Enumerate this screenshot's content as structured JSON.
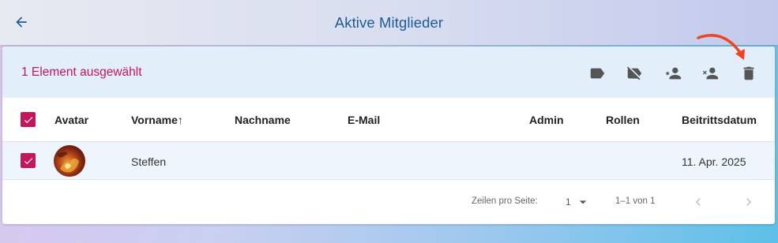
{
  "appbar": {
    "title": "Aktive Mitglieder"
  },
  "selection": {
    "count_label": "1 Element ausgewählt"
  },
  "toolbar_icons": [
    "label-icon",
    "label-off-icon",
    "person-star-icon",
    "person-remove-icon",
    "delete-icon"
  ],
  "table": {
    "columns": [
      "Avatar",
      "Vorname",
      "Nachname",
      "E-Mail",
      "Admin",
      "Rollen",
      "Beitrittsdatum"
    ],
    "sort_indicator": "↑",
    "rows": [
      {
        "selected": true,
        "vorname": "Steffen",
        "nachname": "",
        "email": "",
        "admin": "",
        "rollen": "",
        "beitrittsdatum": "11. Apr. 2025"
      }
    ]
  },
  "footer": {
    "rows_per_page_label": "Zeilen pro Seite:",
    "rows_per_page_value": "1",
    "range_label": "1–1 von 1"
  },
  "colors": {
    "accent": "#c2185b",
    "title": "#1d5a9a",
    "annotation_arrow": "#f0441f"
  }
}
